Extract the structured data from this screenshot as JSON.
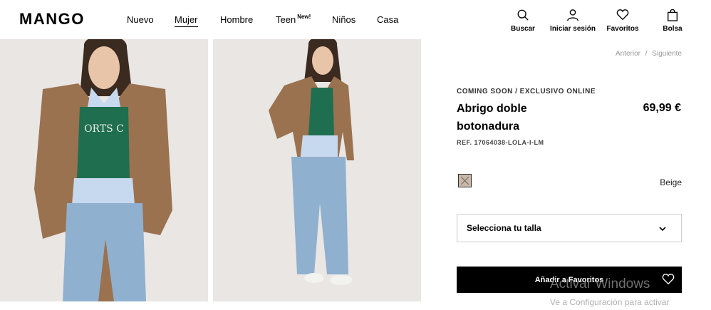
{
  "header": {
    "logo": "MANGO",
    "nav": [
      {
        "label": "Nuevo"
      },
      {
        "label": "Mujer",
        "active": true
      },
      {
        "label": "Hombre"
      },
      {
        "label": "Teen",
        "badge": "New!"
      },
      {
        "label": "Niños"
      },
      {
        "label": "Casa"
      }
    ],
    "actions": [
      {
        "label": "Buscar",
        "icon": "search-icon"
      },
      {
        "label": "Iniciar sesión",
        "icon": "user-icon"
      },
      {
        "label": "Favoritos",
        "icon": "heart-icon"
      },
      {
        "label": "Bolsa",
        "icon": "bag-icon"
      }
    ]
  },
  "pager": {
    "prev": "Anterior",
    "separator": "/",
    "next": "Siguiente"
  },
  "product": {
    "eyebrow": "COMING SOON / EXCLUSIVO ONLINE",
    "title": "Abrigo doble botonadura",
    "price": "69,99 €",
    "ref": "REF. 17064038-LOLA-I-LM",
    "color": {
      "name": "Beige",
      "swatch": "#c8b8a8"
    },
    "size_select": {
      "label": "Selecciona tu talla"
    },
    "add_button": {
      "label": "Añadir a Favoritos"
    }
  },
  "os_watermark": {
    "line1": "Activar Windows",
    "line2": "Ve a Configuración para activar"
  },
  "colors": {
    "photo_bg": "#e9e6e3",
    "coat": "#9a7250",
    "sweater": "#1f6e4f",
    "jeans": "#8fb0cf"
  }
}
